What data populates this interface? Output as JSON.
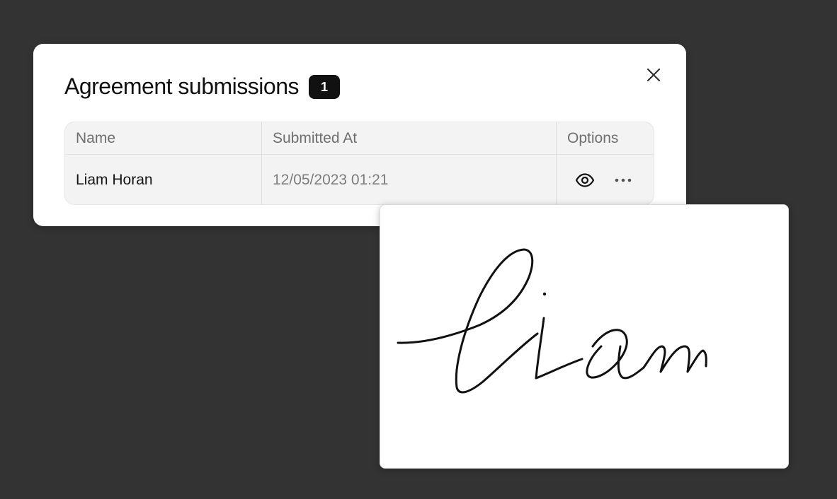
{
  "modal": {
    "title": "Agreement submissions",
    "count": "1",
    "close_icon": "close-icon"
  },
  "table": {
    "columns": [
      "Name",
      "Submitted At",
      "Options"
    ],
    "rows": [
      {
        "name": "Liam Horan",
        "submitted_at": "12/05/2023 01:21",
        "options": [
          "eye-icon",
          "more-horizontal-icon"
        ]
      }
    ]
  },
  "signature": {
    "text": "liam"
  }
}
